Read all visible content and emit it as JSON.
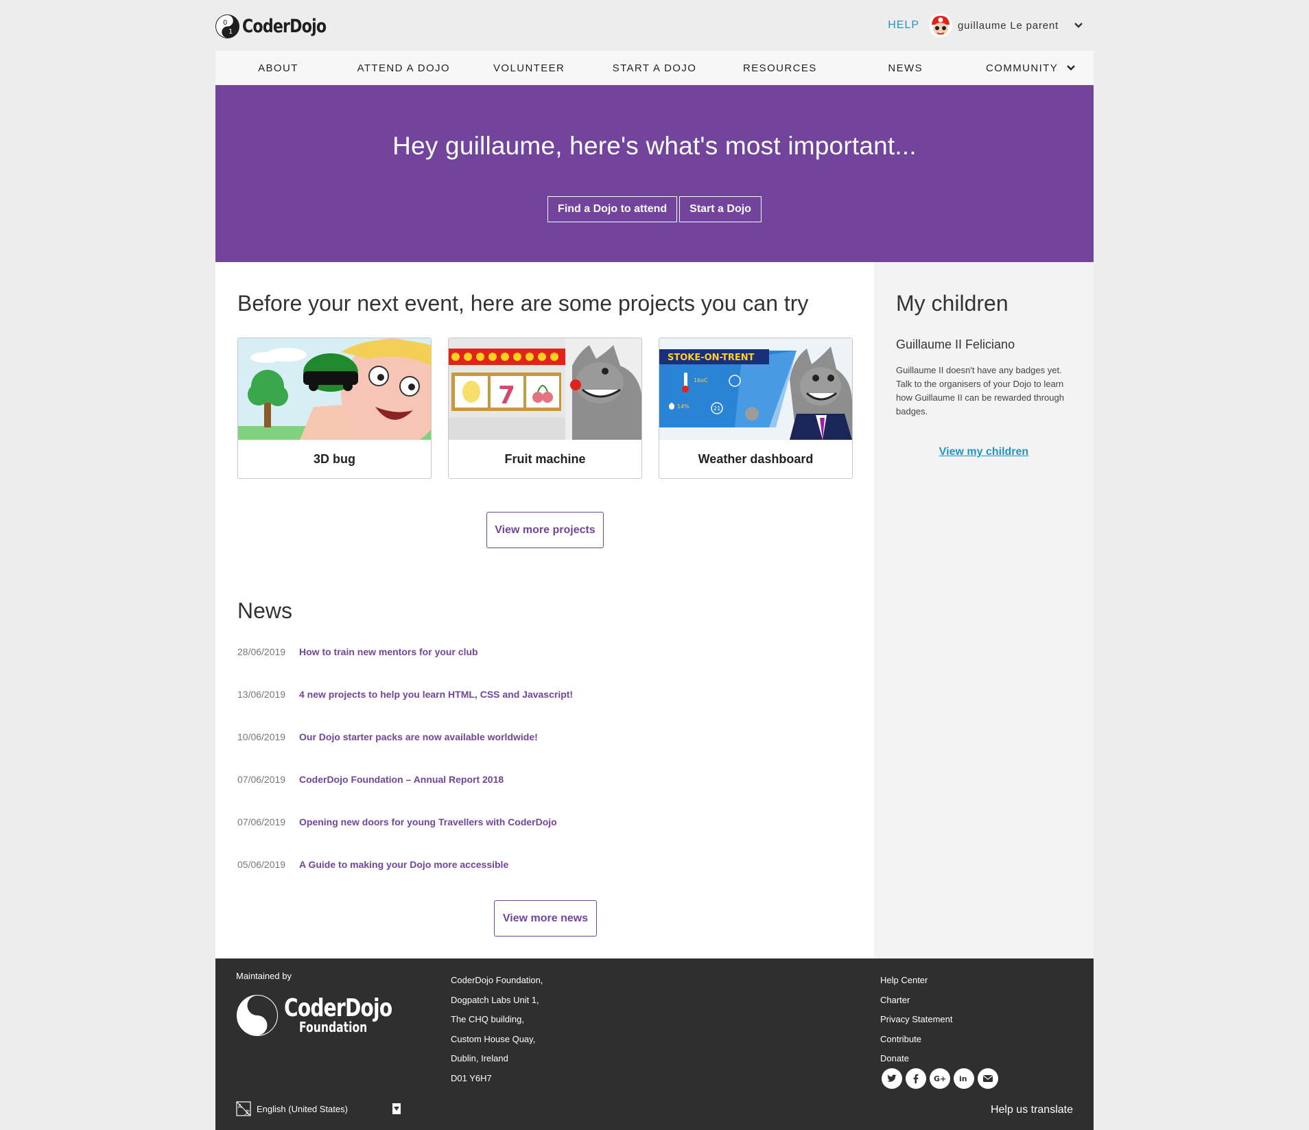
{
  "header": {
    "logo_text": "CoderDojo",
    "help_label": "HELP",
    "user_name": "guillaume Le parent"
  },
  "nav": {
    "items": [
      {
        "label": "ABOUT"
      },
      {
        "label": "ATTEND A DOJO"
      },
      {
        "label": "VOLUNTEER"
      },
      {
        "label": "START A DOJO"
      },
      {
        "label": "RESOURCES"
      },
      {
        "label": "NEWS"
      },
      {
        "label": "COMMUNITY"
      }
    ]
  },
  "hero": {
    "title": "Hey guillaume, here's what's most important...",
    "find_button": "Find a Dojo to attend",
    "start_button": "Start a Dojo"
  },
  "projects": {
    "title": "Before your next event, here are some projects you can try",
    "items": [
      {
        "title": "3D bug"
      },
      {
        "title": "Fruit machine"
      },
      {
        "title": "Weather dashboard",
        "banner": "STOKE-ON-TRENT",
        "temp": "16oC",
        "humidity": "14%",
        "wind": "21"
      }
    ],
    "more_button": "View more projects"
  },
  "news": {
    "title": "News",
    "items": [
      {
        "date": "28/06/2019",
        "title": "How to train new mentors for your club"
      },
      {
        "date": "13/06/2019",
        "title": "4 new projects to help you learn HTML, CSS and Javascript!"
      },
      {
        "date": "10/06/2019",
        "title": "Our Dojo starter packs are now available worldwide!"
      },
      {
        "date": "07/06/2019",
        "title": "CoderDojo Foundation – Annual Report 2018"
      },
      {
        "date": "07/06/2019",
        "title": "Opening new doors for young Travellers with CoderDojo"
      },
      {
        "date": "05/06/2019",
        "title": "A Guide to making your Dojo more accessible"
      }
    ],
    "more_button": "View more news"
  },
  "children": {
    "title": "My children",
    "child_name": "Guillaume II Feliciano",
    "description": "Guillaume II doesn't have any badges yet. Talk to the organisers of your Dojo to learn how Guillaume II can be rewarded through badges.",
    "view_link": "View my children"
  },
  "footer": {
    "maintained_by": "Maintained by",
    "logo_line1": "CoderDojo",
    "logo_line2": "Foundation",
    "address": [
      "CoderDojo Foundation,",
      "Dogpatch Labs Unit 1,",
      "The CHQ building,",
      "Custom House Quay,",
      "Dublin, Ireland",
      "D01 Y6H7"
    ],
    "links": [
      "Help Center",
      "Charter",
      "Privacy Statement",
      "Contribute",
      "Donate"
    ],
    "socials": [
      "twitter-icon",
      "facebook-icon",
      "google-plus-icon",
      "linkedin-icon",
      "email-icon"
    ],
    "language": "English (United States)",
    "help_translate": "Help us translate"
  },
  "colors": {
    "brand_purple": "#73449b",
    "link_blue": "#1a97c9",
    "footer_bg": "#2f2f2f"
  }
}
